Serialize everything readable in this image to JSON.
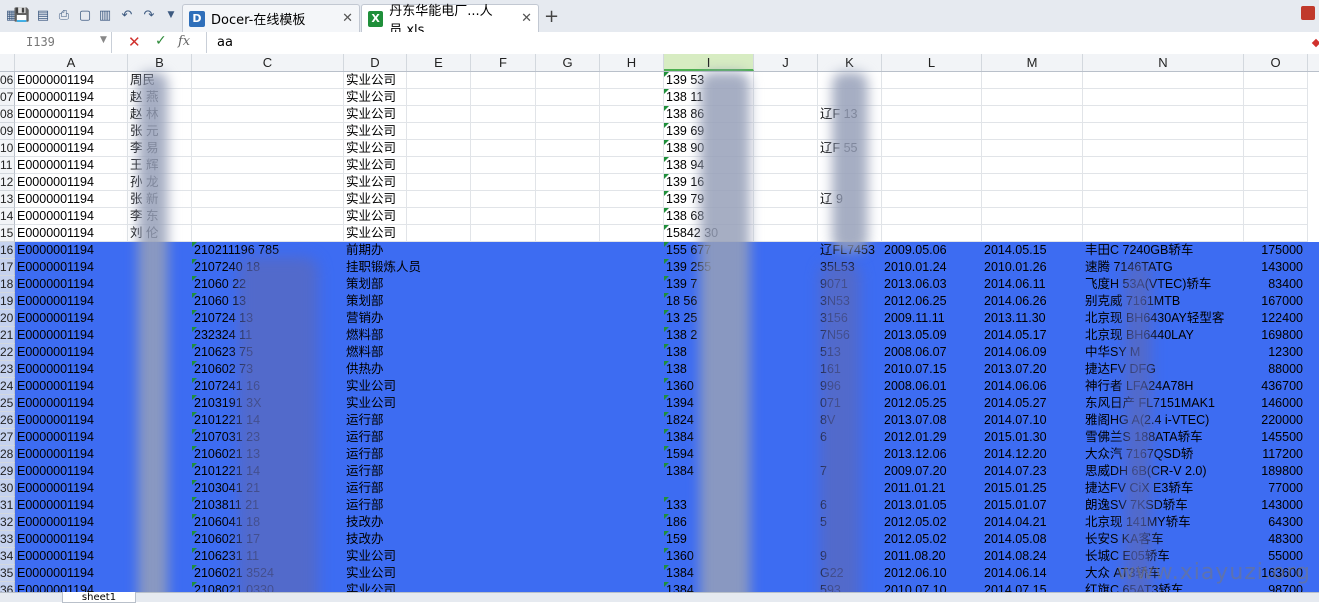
{
  "tabs": [
    {
      "label": "Docer-在线模板",
      "icon": "docer-icon"
    },
    {
      "label": "丹东华能电厂...人员.xls",
      "icon": "excel-icon"
    }
  ],
  "formula": {
    "cell_ref": "I139",
    "value": "aa"
  },
  "columns": [
    "A",
    "B",
    "C",
    "D",
    "E",
    "F",
    "G",
    "H",
    "I",
    "J",
    "K",
    "L",
    "M",
    "N",
    "O"
  ],
  "active_column": "I",
  "rows": [
    {
      "n": "06",
      "a": "E0000001194",
      "b": "周民",
      "c": "",
      "d": "实业公司",
      "i": "139  53",
      "k": "",
      "l": "",
      "m": "",
      "nn": "",
      "o": "",
      "sel": false
    },
    {
      "n": "07",
      "a": "E0000001194",
      "b": "赵 燕",
      "c": "",
      "d": "实业公司",
      "i": "138  11",
      "k": "",
      "l": "",
      "m": "",
      "nn": "",
      "o": "",
      "sel": false
    },
    {
      "n": "08",
      "a": "E0000001194",
      "b": "赵 林",
      "c": "",
      "d": "实业公司",
      "i": "138  86",
      "k": "辽F  13",
      "l": "",
      "m": "",
      "nn": "",
      "o": "",
      "sel": false
    },
    {
      "n": "09",
      "a": "E0000001194",
      "b": "张 元",
      "c": "",
      "d": "实业公司",
      "i": "139  69",
      "k": "",
      "l": "",
      "m": "",
      "nn": "",
      "o": "",
      "sel": false
    },
    {
      "n": "10",
      "a": "E0000001194",
      "b": "李 易",
      "c": "",
      "d": "实业公司",
      "i": "138  90",
      "k": "辽F  55",
      "l": "",
      "m": "",
      "nn": "",
      "o": "",
      "sel": false
    },
    {
      "n": "11",
      "a": "E0000001194",
      "b": "王 辉",
      "c": "",
      "d": "实业公司",
      "i": "138  94",
      "k": "",
      "l": "",
      "m": "",
      "nn": "",
      "o": "",
      "sel": false
    },
    {
      "n": "12",
      "a": "E0000001194",
      "b": "孙 龙",
      "c": "",
      "d": "实业公司",
      "i": "139  16",
      "k": "",
      "l": "",
      "m": "",
      "nn": "",
      "o": "",
      "sel": false
    },
    {
      "n": "13",
      "a": "E0000001194",
      "b": "张 新",
      "c": "",
      "d": "实业公司",
      "i": "139  79",
      "k": "辽  9",
      "l": "",
      "m": "",
      "nn": "",
      "o": "",
      "sel": false
    },
    {
      "n": "14",
      "a": "E0000001194",
      "b": "李 东",
      "c": "",
      "d": "实业公司",
      "i": "138  68",
      "k": "",
      "l": "",
      "m": "",
      "nn": "",
      "o": "",
      "sel": false
    },
    {
      "n": "15",
      "a": "E0000001194",
      "b": "刘 伦",
      "c": "",
      "d": "实业公司",
      "i": "15842  30",
      "k": "",
      "l": "",
      "m": "",
      "nn": "",
      "o": "",
      "sel": false
    },
    {
      "n": "16",
      "a": "E0000001194",
      "b": "",
      "c": "210211196  785",
      "d": "前期办",
      "i": "155  677",
      "k": "辽FL7453",
      "l": "2009.05.06",
      "m": "2014.05.15",
      "nn": "丰田C  7240GB轿车",
      "o": "175000",
      "sel": true
    },
    {
      "n": "17",
      "a": "E0000001194",
      "b": "",
      "c": "2107240  18",
      "d": "挂职锻炼人员",
      "i": "139  255",
      "k": "35L53",
      "l": "2010.01.24",
      "m": "2010.01.26",
      "nn": "速腾  7146TATG",
      "o": "143000",
      "sel": true
    },
    {
      "n": "18",
      "a": "E0000001194",
      "b": "",
      "c": "21060  22",
      "d": "策划部",
      "i": "139  7",
      "k": "9071",
      "l": "2013.06.03",
      "m": "2014.06.11",
      "nn": "飞度H  53A(VTEC)轿车",
      "o": "83400",
      "sel": true
    },
    {
      "n": "19",
      "a": "E0000001194",
      "b": "",
      "c": "21060  13",
      "d": "策划部",
      "i": "18  56",
      "k": "3N53",
      "l": "2012.06.25",
      "m": "2014.06.26",
      "nn": "别克威  7161MTB",
      "o": "167000",
      "sel": true
    },
    {
      "n": "20",
      "a": "E0000001194",
      "b": "",
      "c": "210724  13",
      "d": "营销办",
      "i": "13  25",
      "k": "3156",
      "l": "2009.11.11",
      "m": "2013.11.30",
      "nn": "北京现  BH6430AY轻型客",
      "o": "122400",
      "sel": true
    },
    {
      "n": "21",
      "a": "E0000001194",
      "b": "",
      "c": "232324  11",
      "d": "燃料部",
      "i": "138  2",
      "k": "7N56",
      "l": "2013.05.09",
      "m": "2014.05.17",
      "nn": "北京现  BH6440LAY",
      "o": "169800",
      "sel": true
    },
    {
      "n": "22",
      "a": "E0000001194",
      "b": "",
      "c": "210623  75",
      "d": "燃料部",
      "i": "138",
      "k": "513",
      "l": "2008.06.07",
      "m": "2014.06.09",
      "nn": "中华SY  M",
      "o": "12300",
      "sel": true
    },
    {
      "n": "23",
      "a": "E0000001194",
      "b": "",
      "c": "210602  73",
      "d": "供热办",
      "i": "138",
      "k": "161",
      "l": "2010.07.15",
      "m": "2013.07.20",
      "nn": "捷达FV  DFG",
      "o": "88000",
      "sel": true
    },
    {
      "n": "24",
      "a": "E0000001194",
      "b": "",
      "c": "2107241  16",
      "d": "实业公司",
      "i": "1360",
      "k": "996",
      "l": "2008.06.01",
      "m": "2014.06.06",
      "nn": "神行者  LFA24A78H",
      "o": "436700",
      "sel": true
    },
    {
      "n": "25",
      "a": "E0000001194",
      "b": "",
      "c": "2103191  3X",
      "d": "实业公司",
      "i": "1394",
      "k": "071",
      "l": "2012.05.25",
      "m": "2014.05.27",
      "nn": "东风日产  FL7151MAK1",
      "o": "146000",
      "sel": true
    },
    {
      "n": "26",
      "a": "E0000001194",
      "b": "",
      "c": "2101221  14",
      "d": "运行部",
      "i": "1824",
      "k": "8V",
      "l": "2013.07.08",
      "m": "2014.07.10",
      "nn": "雅阁HG  A(2.4 i-VTEC)",
      "o": "220000",
      "sel": true
    },
    {
      "n": "27",
      "a": "E0000001194",
      "b": "",
      "c": "2107031  23",
      "d": "运行部",
      "i": "1384",
      "k": "6",
      "l": "2012.01.29",
      "m": "2015.01.30",
      "nn": "雪佛兰S  188ATA轿车",
      "o": "145500",
      "sel": true
    },
    {
      "n": "28",
      "a": "E0000001194",
      "b": "",
      "c": "2106021  13",
      "d": "运行部",
      "i": "1594",
      "k": "",
      "l": "2013.12.06",
      "m": "2014.12.20",
      "nn": "大众汽  7167QSD轿",
      "o": "117200",
      "sel": true
    },
    {
      "n": "29",
      "a": "E0000001194",
      "b": "",
      "c": "2101221  14",
      "d": "运行部",
      "i": "1384",
      "k": "7",
      "l": "2009.07.20",
      "m": "2014.07.23",
      "nn": "思威DH  6B(CR-V 2.0)",
      "o": "189800",
      "sel": true
    },
    {
      "n": "30",
      "a": "E0000001194",
      "b": "",
      "c": "2103041  21",
      "d": "运行部",
      "i": "",
      "k": "",
      "l": "2011.01.21",
      "m": "2015.01.25",
      "nn": "捷达FV  CiX E3轿车",
      "o": "77000",
      "sel": true
    },
    {
      "n": "31",
      "a": "E0000001194",
      "b": "",
      "c": "2103811  21",
      "d": "运行部",
      "i": "133",
      "k": "6",
      "l": "2013.01.05",
      "m": "2015.01.07",
      "nn": "朗逸SV  7KSD轿车",
      "o": "143000",
      "sel": true
    },
    {
      "n": "32",
      "a": "E0000001194",
      "b": "",
      "c": "2106041  18",
      "d": "技改办",
      "i": "186",
      "k": "5",
      "l": "2012.05.02",
      "m": "2014.04.21",
      "nn": "北京现  141MY轿车",
      "o": "64300",
      "sel": true
    },
    {
      "n": "33",
      "a": "E0000001194",
      "b": "",
      "c": "2106021  17",
      "d": "技改办",
      "i": "159",
      "k": "",
      "l": "2012.05.02",
      "m": "2014.05.08",
      "nn": "长安S  KA客车",
      "o": "48300",
      "sel": true
    },
    {
      "n": "34",
      "a": "E0000001194",
      "b": "",
      "c": "2106231  11",
      "d": "实业公司",
      "i": "1360",
      "k": "9",
      "l": "2011.08.20",
      "m": "2014.08.24",
      "nn": "长城C  E05轿车",
      "o": "55000",
      "sel": true
    },
    {
      "n": "35",
      "a": "E0000001194",
      "b": "",
      "c": "2106021  3524",
      "d": "实业公司",
      "i": "1384",
      "k": "G22",
      "l": "2012.06.10",
      "m": "2014.06.14",
      "nn": "大众  AT3轿车",
      "o": "163600",
      "sel": true
    },
    {
      "n": "36",
      "a": "E0000001194",
      "b": "",
      "c": "2108021  0330",
      "d": "实业公司",
      "i": "1384",
      "k": "593",
      "l": "2010.07.10",
      "m": "2014.07.15",
      "nn": "红旗C  65AT3轿车",
      "o": "98700",
      "sel": true
    }
  ],
  "sheet_tab": "sheet1",
  "watermark": "www.xiayuzi.org"
}
